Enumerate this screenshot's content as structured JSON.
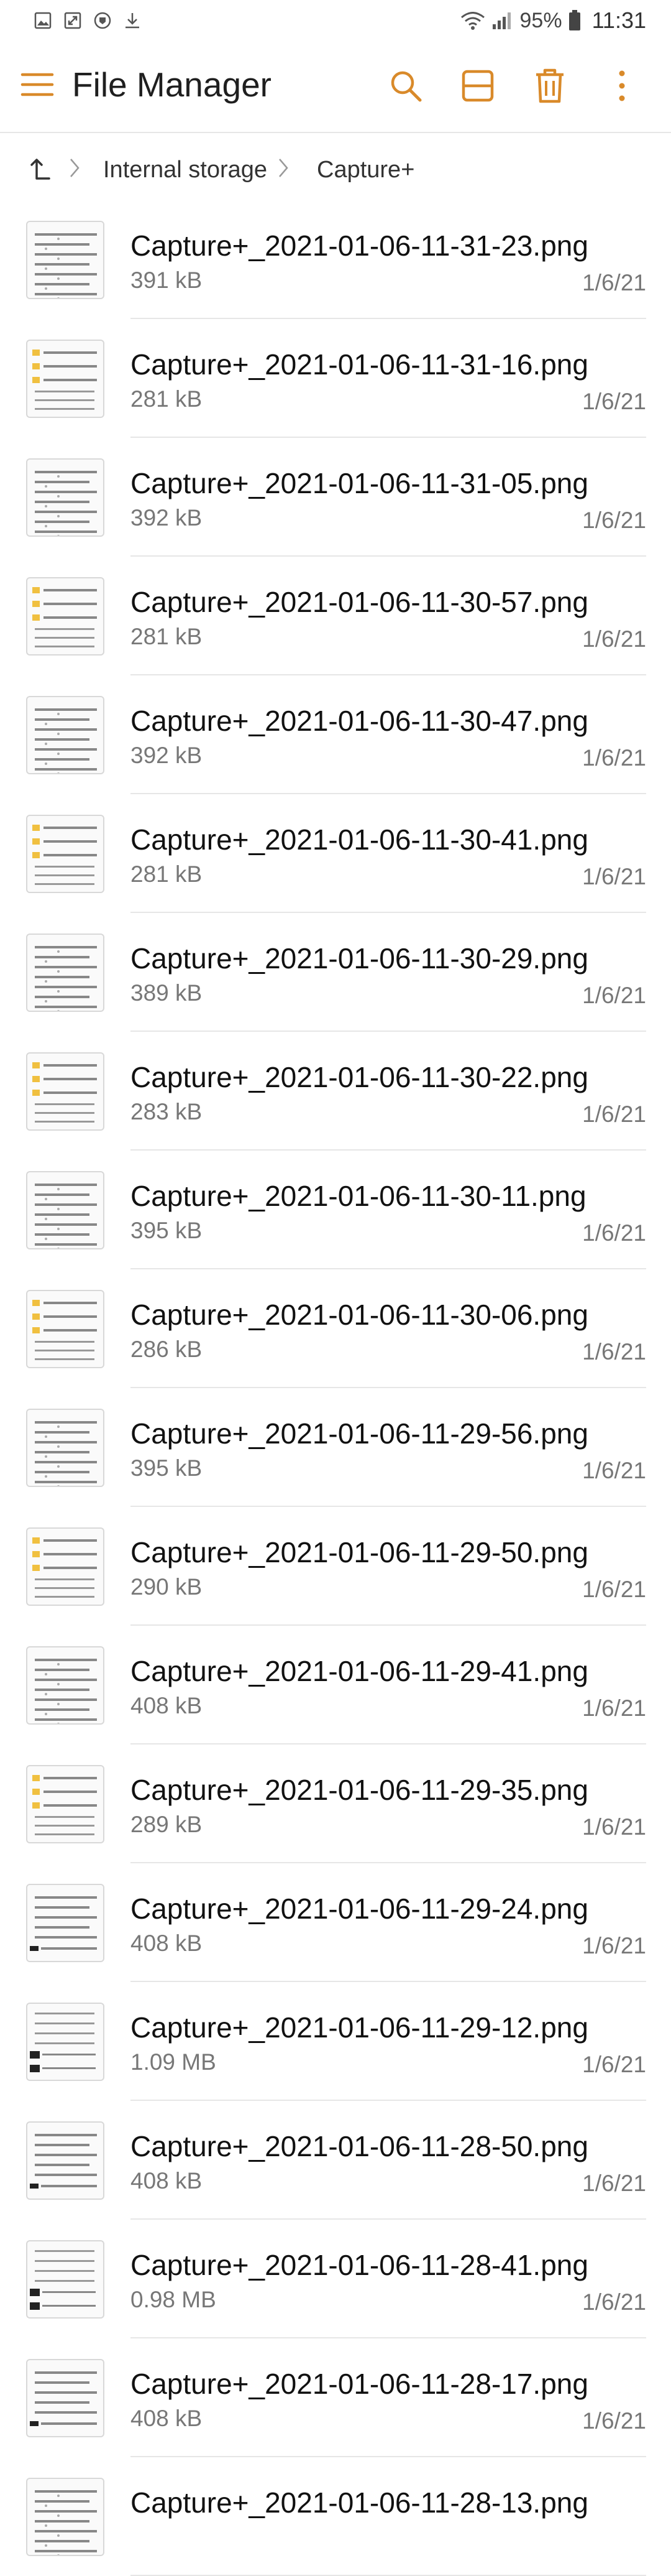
{
  "status_bar": {
    "battery": "95%",
    "time": "11:31",
    "icons": [
      "image-icon",
      "screenshot-icon",
      "vpn-icon",
      "download-icon",
      "wifi-icon",
      "signal-icon",
      "battery-icon"
    ]
  },
  "app_bar": {
    "title": "File Manager",
    "actions": [
      "search-icon",
      "layout-icon",
      "trash-icon",
      "more-icon"
    ],
    "accent": "#d98a2a"
  },
  "breadcrumb": {
    "items": [
      "Internal storage",
      "Capture+"
    ]
  },
  "files": [
    {
      "name": "Capture+_2021-01-06-11-31-23.png",
      "size": "391 kB",
      "date": "1/6/21",
      "thumb": "list"
    },
    {
      "name": "Capture+_2021-01-06-11-31-16.png",
      "size": "281 kB",
      "date": "1/6/21",
      "thumb": "folders"
    },
    {
      "name": "Capture+_2021-01-06-11-31-05.png",
      "size": "392 kB",
      "date": "1/6/21",
      "thumb": "list"
    },
    {
      "name": "Capture+_2021-01-06-11-30-57.png",
      "size": "281 kB",
      "date": "1/6/21",
      "thumb": "folders"
    },
    {
      "name": "Capture+_2021-01-06-11-30-47.png",
      "size": "392 kB",
      "date": "1/6/21",
      "thumb": "list"
    },
    {
      "name": "Capture+_2021-01-06-11-30-41.png",
      "size": "281 kB",
      "date": "1/6/21",
      "thumb": "folders"
    },
    {
      "name": "Capture+_2021-01-06-11-30-29.png",
      "size": "389 kB",
      "date": "1/6/21",
      "thumb": "list"
    },
    {
      "name": "Capture+_2021-01-06-11-30-22.png",
      "size": "283 kB",
      "date": "1/6/21",
      "thumb": "folders"
    },
    {
      "name": "Capture+_2021-01-06-11-30-11.png",
      "size": "395 kB",
      "date": "1/6/21",
      "thumb": "list"
    },
    {
      "name": "Capture+_2021-01-06-11-30-06.png",
      "size": "286 kB",
      "date": "1/6/21",
      "thumb": "folders"
    },
    {
      "name": "Capture+_2021-01-06-11-29-56.png",
      "size": "395 kB",
      "date": "1/6/21",
      "thumb": "list"
    },
    {
      "name": "Capture+_2021-01-06-11-29-50.png",
      "size": "290 kB",
      "date": "1/6/21",
      "thumb": "folders"
    },
    {
      "name": "Capture+_2021-01-06-11-29-41.png",
      "size": "408 kB",
      "date": "1/6/21",
      "thumb": "list"
    },
    {
      "name": "Capture+_2021-01-06-11-29-35.png",
      "size": "289 kB",
      "date": "1/6/21",
      "thumb": "folders"
    },
    {
      "name": "Capture+_2021-01-06-11-29-24.png",
      "size": "408 kB",
      "date": "1/6/21",
      "thumb": "list-dark"
    },
    {
      "name": "Capture+_2021-01-06-11-29-12.png",
      "size": "1.09 MB",
      "date": "1/6/21",
      "thumb": "dark"
    },
    {
      "name": "Capture+_2021-01-06-11-28-50.png",
      "size": "408 kB",
      "date": "1/6/21",
      "thumb": "list-dark"
    },
    {
      "name": "Capture+_2021-01-06-11-28-41.png",
      "size": "0.98 MB",
      "date": "1/6/21",
      "thumb": "dark"
    },
    {
      "name": "Capture+_2021-01-06-11-28-17.png",
      "size": "408 kB",
      "date": "1/6/21",
      "thumb": "list-dark"
    },
    {
      "name": "Capture+_2021-01-06-11-28-13.png",
      "size": "",
      "date": "",
      "thumb": "list"
    }
  ]
}
